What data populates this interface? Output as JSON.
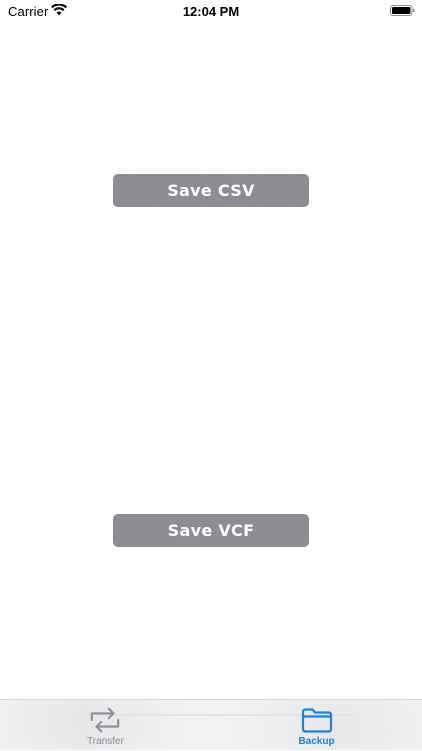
{
  "status_bar": {
    "carrier": "Carrier",
    "time": "12:04 PM",
    "icons": [
      "wifi-icon",
      "battery-icon"
    ]
  },
  "buttons": {
    "save_csv": "Save CSV",
    "save_vcf": "Save VCF",
    "color": "#8e8e92",
    "text_color": "#ffffff"
  },
  "tab_bar": {
    "items": [
      {
        "label": "Transfer",
        "icon": "transfer-arrows-icon",
        "selected": false,
        "color": "#8e8e93"
      },
      {
        "label": "Backup",
        "icon": "folder-icon",
        "selected": true,
        "color": "#1a82e0"
      }
    ]
  }
}
